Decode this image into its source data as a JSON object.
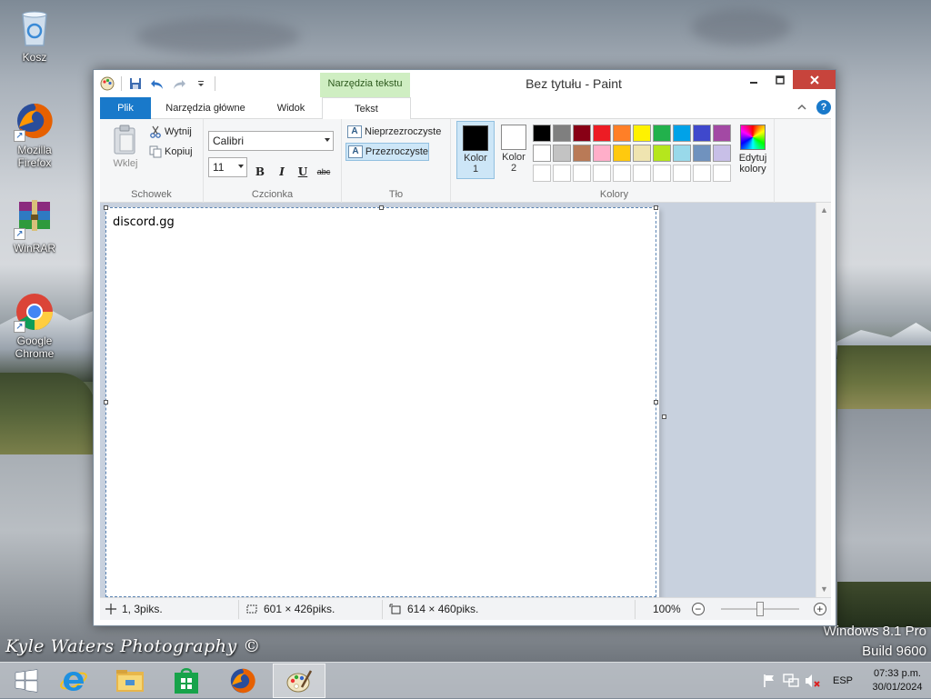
{
  "desktop": {
    "icons": [
      {
        "label": "Kosz"
      },
      {
        "label": "Mozilla Firefox"
      },
      {
        "label": "WinRAR"
      },
      {
        "label": "Google Chrome"
      }
    ],
    "watermark": "Kyle Waters Photography ©",
    "os_version": {
      "line1": "Windows 8.1 Pro",
      "line2": "Build 9600"
    }
  },
  "window": {
    "title": "Bez tytułu - Paint",
    "contextual_group": "Narzędzia tekstu",
    "tabs": {
      "file": "Plik",
      "home": "Narzędzia główne",
      "view": "Widok",
      "text": "Tekst"
    },
    "ribbon": {
      "clipboard": {
        "label": "Schowek",
        "paste": "Wklej",
        "cut": "Wytnij",
        "copy": "Kopiuj"
      },
      "font": {
        "label": "Czcionka",
        "family": "Calibri",
        "size": "11",
        "bold": "B",
        "italic": "I",
        "underline": "U",
        "strikethrough": "abc"
      },
      "background": {
        "label": "Tło",
        "opaque": "Nieprzezroczyste",
        "transparent": "Przezroczyste",
        "selected": "transparent"
      },
      "colors": {
        "label": "Kolory",
        "color1": {
          "label": "Kolor",
          "num": "1",
          "value": "#000000"
        },
        "color2": {
          "label": "Kolor",
          "num": "2",
          "value": "#ffffff"
        },
        "edit": {
          "line1": "Edytuj",
          "line2": "kolory"
        },
        "palette": [
          "#000000",
          "#7f7f7f",
          "#880015",
          "#ed1c24",
          "#ff7f27",
          "#fff200",
          "#22b14c",
          "#00a2e8",
          "#3f48cc",
          "#a349a4",
          "#ffffff",
          "#c3c3c3",
          "#b97a57",
          "#ffaec9",
          "#ffc90e",
          "#efe4b0",
          "#b5e61d",
          "#99d9ea",
          "#7092be",
          "#c8bfe7",
          "#ffffff",
          "#ffffff",
          "#ffffff",
          "#ffffff",
          "#ffffff",
          "#ffffff",
          "#ffffff",
          "#ffffff",
          "#ffffff",
          "#ffffff"
        ]
      }
    },
    "canvas": {
      "text": "discord.gg"
    },
    "status": {
      "cursor": "1, 3piks.",
      "selection": "601 × 426piks.",
      "image_size": "614 × 460piks.",
      "zoom": "100%"
    }
  },
  "taskbar": {
    "apps": [
      "start",
      "internet-explorer",
      "file-explorer",
      "store",
      "firefox",
      "paint"
    ],
    "active": "paint",
    "language": "ESP",
    "time": "07:33 p.m.",
    "date": "30/01/2024"
  }
}
